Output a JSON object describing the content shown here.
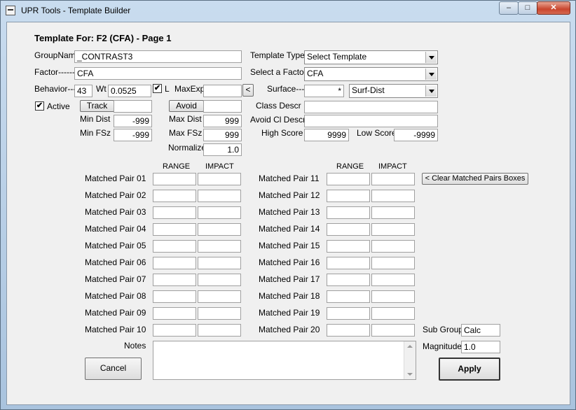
{
  "window": {
    "title": "UPR Tools - Template Builder",
    "min_glyph": "–",
    "max_glyph": "□",
    "close_glyph": "✕"
  },
  "header": {
    "template_for": "Template For: F2 (CFA) - Page 1"
  },
  "fields": {
    "groupname_label": "GroupName",
    "groupname_value": "_CONTRAST3",
    "factor_label": "Factor------",
    "factor_value": "CFA",
    "behavior_label": "Behavior---",
    "behavior_value": "43",
    "wt_label": "Wt",
    "wt_value": "0.0525",
    "l_label": "L",
    "l_checked": "✔",
    "maxexp_label": "MaxExp",
    "maxexp_value": "",
    "maxexp_button": "<",
    "active_label": "Active",
    "active_checked": "✔",
    "track_button": "Track",
    "track_value": "",
    "avoid_button": "Avoid",
    "avoid_value": "",
    "mindist_label": "Min Dist",
    "mindist_value": "-999",
    "maxdist_label": "Max Dist",
    "maxdist_value": "999",
    "minfsz_label": "Min FSz",
    "minfsz_value": "-999",
    "maxfsz_label": "Max FSz",
    "maxfsz_value": "999",
    "normalize_label": "Normalize",
    "normalize_value": "1.0",
    "template_type_label": "Template Type--",
    "template_type_value": "Select Template",
    "select_factor_label": "Select a Factor-",
    "select_factor_value": "CFA",
    "surface_label": "Surface---",
    "surface_value": "*",
    "surface_type_value": "Surf-Dist",
    "class_descr_label": "Class Descr",
    "class_descr_value": "",
    "avoid_cl_descr_label": "Avoid Cl Descr",
    "avoid_cl_descr_value": "",
    "high_score_label": "High Score",
    "high_score_value": "9999",
    "low_score_label": "Low Score",
    "low_score_value": "-9999"
  },
  "matched_pairs": {
    "range_header": "RANGE",
    "impact_header": "IMPACT",
    "clear_button": "< Clear Matched Pairs Boxes",
    "left": [
      {
        "label": "Matched Pair 01",
        "range": "",
        "impact": ""
      },
      {
        "label": "Matched Pair 02",
        "range": "",
        "impact": ""
      },
      {
        "label": "Matched Pair 03",
        "range": "",
        "impact": ""
      },
      {
        "label": "Matched Pair 04",
        "range": "",
        "impact": ""
      },
      {
        "label": "Matched Pair 05",
        "range": "",
        "impact": ""
      },
      {
        "label": "Matched Pair 06",
        "range": "",
        "impact": ""
      },
      {
        "label": "Matched Pair 07",
        "range": "",
        "impact": ""
      },
      {
        "label": "Matched Pair 08",
        "range": "",
        "impact": ""
      },
      {
        "label": "Matched Pair 09",
        "range": "",
        "impact": ""
      },
      {
        "label": "Matched Pair 10",
        "range": "",
        "impact": ""
      }
    ],
    "right": [
      {
        "label": "Matched Pair 11",
        "range": "",
        "impact": ""
      },
      {
        "label": "Matched Pair 12",
        "range": "",
        "impact": ""
      },
      {
        "label": "Matched Pair 13",
        "range": "",
        "impact": ""
      },
      {
        "label": "Matched Pair 14",
        "range": "",
        "impact": ""
      },
      {
        "label": "Matched Pair 15",
        "range": "",
        "impact": ""
      },
      {
        "label": "Matched Pair 16",
        "range": "",
        "impact": ""
      },
      {
        "label": "Matched Pair 17",
        "range": "",
        "impact": ""
      },
      {
        "label": "Matched Pair 18",
        "range": "",
        "impact": ""
      },
      {
        "label": "Matched Pair 19",
        "range": "",
        "impact": ""
      },
      {
        "label": "Matched Pair 20",
        "range": "",
        "impact": ""
      }
    ]
  },
  "bottom": {
    "notes_label": "Notes",
    "notes_value": "",
    "cancel_button": "Cancel",
    "apply_button": "Apply",
    "sub_group_label": "Sub Group",
    "sub_group_value": "Calc",
    "magnitude_label": "Magnitude",
    "magnitude_value": "1.0"
  }
}
